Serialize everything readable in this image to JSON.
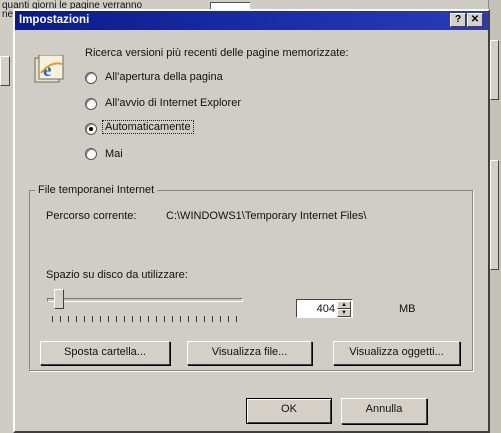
{
  "background": {
    "line1": "quanti giorni le pagine verranno",
    "line2": "nel"
  },
  "dialog": {
    "title": "Impostazioni",
    "help_glyph": "?",
    "close_glyph": "✕"
  },
  "check_newer": {
    "heading": "Ricerca versioni più recenti delle pagine memorizzate:",
    "options": [
      {
        "label": "All'apertura della pagina",
        "checked": false
      },
      {
        "label": "All'avvio di Internet Explorer",
        "checked": false
      },
      {
        "label": "Automaticamente",
        "checked": true
      },
      {
        "label": "Mai",
        "checked": false
      }
    ]
  },
  "temp_files": {
    "group_title": "File temporanei Internet",
    "path_label": "Percorso corrente:",
    "path_value": "C:\\WINDOWS1\\Temporary Internet Files\\",
    "disk_label": "Spazio su disco da utilizzare:",
    "disk_value": "404",
    "disk_unit": "MB",
    "slider_level": 0.04,
    "move_folder": "Sposta cartella...",
    "view_files": "Visualizza file...",
    "view_objects": "Visualizza oggetti..."
  },
  "footer": {
    "ok": "OK",
    "cancel": "Annulla"
  },
  "icons": {
    "ie": "internet-explorer-icon",
    "help": "help-icon",
    "close": "close-icon"
  },
  "colors": {
    "title_bar": "#0a1a8a",
    "dialog_bg": "#d0cdc6"
  }
}
